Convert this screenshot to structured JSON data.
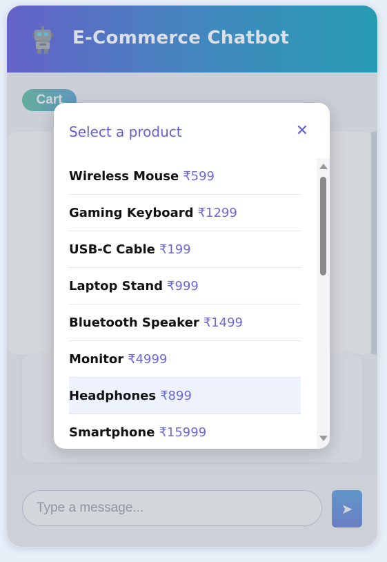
{
  "header": {
    "title": "E-Commerce Chatbot",
    "icon": "robot-icon"
  },
  "cart": {
    "label": "Cart"
  },
  "composer": {
    "placeholder": "Type a message...",
    "send_icon": "send-arrow-icon",
    "send_glyph": "➤"
  },
  "modal": {
    "title": "Select a product",
    "close_glyph": "✕",
    "products": [
      {
        "name": "Wireless Mouse",
        "price": "₹599"
      },
      {
        "name": "Gaming Keyboard",
        "price": "₹1299"
      },
      {
        "name": "USB-C Cable",
        "price": "₹199"
      },
      {
        "name": "Laptop Stand",
        "price": "₹999"
      },
      {
        "name": "Bluetooth Speaker",
        "price": "₹1499"
      },
      {
        "name": "Monitor",
        "price": "₹4999"
      },
      {
        "name": "Headphones",
        "price": "₹899"
      },
      {
        "name": "Smartphone",
        "price": "₹15999"
      }
    ],
    "highlighted_index": 6
  },
  "colors": {
    "accent": "#6460cf",
    "header_start": "#5a55cf",
    "header_end": "#109cb5",
    "cart_start": "#3fb88f",
    "cart_end": "#3a97d2"
  }
}
